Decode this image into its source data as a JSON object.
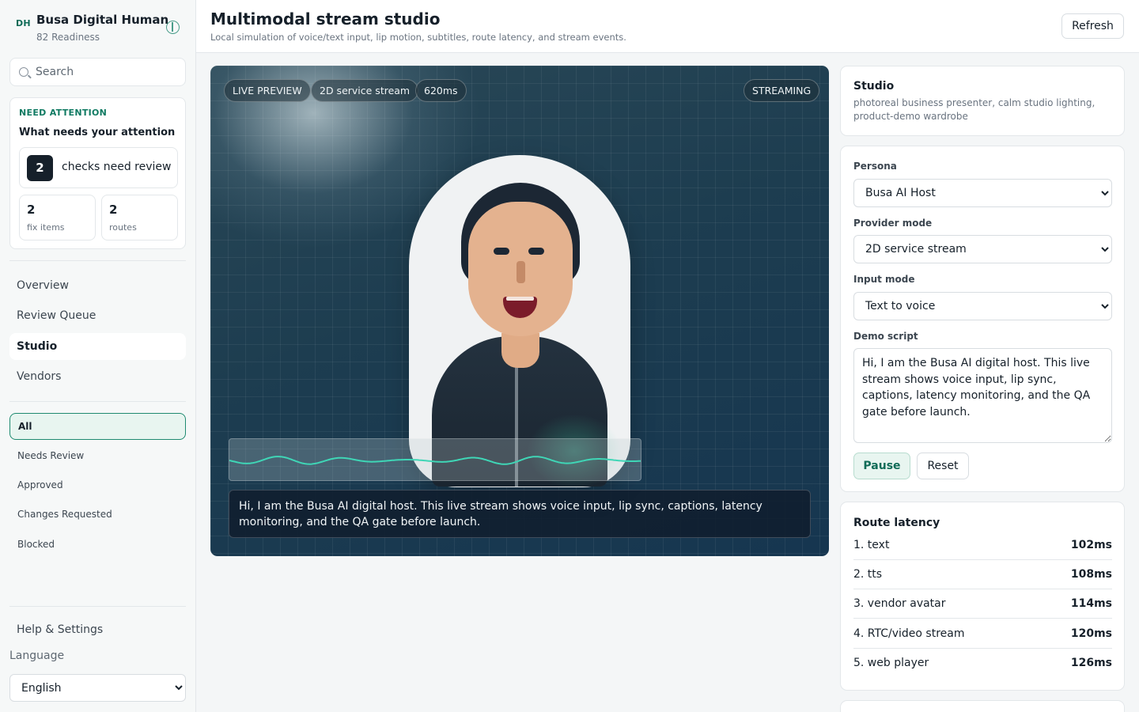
{
  "sidebar": {
    "brand_logo": "DH",
    "brand_name": "Busa Digital Human",
    "brand_sub": "82 Readiness",
    "search_placeholder": "Search",
    "attention": {
      "kicker": "NEED ATTENTION",
      "title": "What needs your attention",
      "review_count": "2",
      "review_label": "checks need review",
      "fix_count": "2",
      "fix_label": "fix items",
      "routes_count": "2",
      "routes_label": "routes"
    },
    "nav": [
      "Overview",
      "Review Queue",
      "Studio",
      "Vendors"
    ],
    "nav_active": "Studio",
    "filters": [
      "All",
      "Needs Review",
      "Approved",
      "Changes Requested",
      "Blocked"
    ],
    "filter_active": "All",
    "help": "Help & Settings",
    "language_label": "Language",
    "language_value": "English"
  },
  "header": {
    "title": "Multimodal stream studio",
    "subtitle": "Local simulation of voice/text input, lip motion, subtitles, route latency, and stream events.",
    "refresh": "Refresh"
  },
  "stage": {
    "pills": [
      "LIVE PREVIEW",
      "2D service stream",
      "620ms"
    ],
    "status": "STREAMING",
    "caption": "Hi, I am the Busa AI digital host. This live stream shows voice input, lip sync, captions, latency monitoring, and the QA gate before launch.",
    "wave_color": "#3fd6b6"
  },
  "studio": {
    "title": "Studio",
    "description": "photoreal business presenter, calm studio lighting, product-demo wardrobe"
  },
  "form": {
    "persona_label": "Persona",
    "persona_value": "Busa AI Host",
    "provider_label": "Provider mode",
    "provider_value": "2D service stream",
    "input_label": "Input mode",
    "input_value": "Text to voice",
    "script_label": "Demo script",
    "script_value": "Hi, I am the Busa AI digital host. This live stream shows voice input, lip sync, captions, latency monitoring, and the QA gate before launch.",
    "pause": "Pause",
    "reset": "Reset"
  },
  "route": {
    "title": "Route latency",
    "rows": [
      {
        "name": "1. text",
        "ms": "102ms"
      },
      {
        "name": "2. tts",
        "ms": "108ms"
      },
      {
        "name": "3. vendor avatar",
        "ms": "114ms"
      },
      {
        "name": "4. RTC/video stream",
        "ms": "120ms"
      },
      {
        "name": "5. web player",
        "ms": "126ms"
      }
    ]
  },
  "colors": {
    "accent": "#0f7a62",
    "stage_dark": "#163650"
  }
}
